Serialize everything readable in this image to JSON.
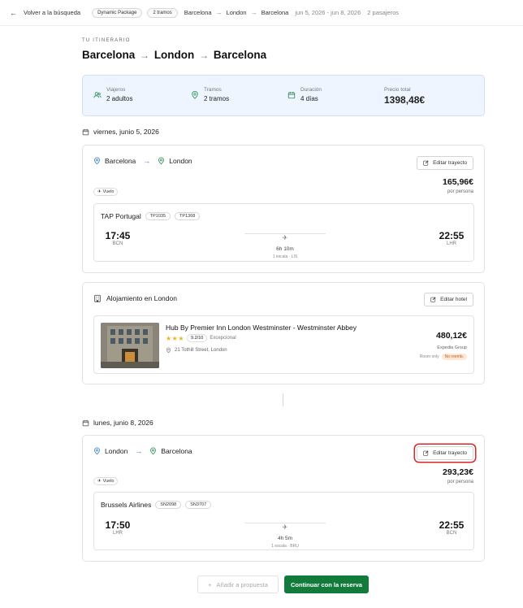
{
  "topbar": {
    "back_label": "Volver a la búsqueda",
    "package_badge": "Dynamic Package",
    "legs_badge": "2 tramos",
    "route": [
      "Barcelona",
      "London",
      "Barcelona"
    ],
    "dates": "jun 5, 2026 - jun 8, 2026",
    "passengers": "2 pasajeros"
  },
  "header": {
    "kicker": "TU ITINERARIO",
    "route": [
      "Barcelona",
      "London",
      "Barcelona"
    ]
  },
  "summary": {
    "travelers_label": "Viajeros",
    "travelers_value": "2 adultos",
    "legs_label": "Tramos",
    "legs_value": "2 tramos",
    "duration_label": "Duración",
    "duration_value": "4 días",
    "price_label": "Precio total",
    "price_value": "1398,48€"
  },
  "day1": {
    "date": "viernes, junio 5, 2026",
    "flight": {
      "from": "Barcelona",
      "to": "London",
      "edit_label": "Editar trayecto",
      "type_badge": "Vuelo",
      "price": "165,96€",
      "per_person": "por persona",
      "airline": "TAP Portugal",
      "codes": [
        "TP1035",
        "TP1368"
      ],
      "dep_time": "17:45",
      "dep_iata": "BCN",
      "duration": "6h 10m",
      "stops": "1 escala · LIS",
      "arr_time": "22:55",
      "arr_iata": "LHR"
    },
    "hotel": {
      "title": "Alojamiento en London",
      "edit_label": "Editar hotel",
      "name": "Hub By Premier Inn London Westminster - Westminster Abbey",
      "stars": 3,
      "rating": "9.2/10",
      "rating_text": "Excepcional",
      "address": "21 Tothill Street, London",
      "price": "480,12€",
      "provider": "Expedia Group",
      "room": "Room only",
      "refund": "No reemb."
    }
  },
  "day2": {
    "date": "lunes, junio 8, 2026",
    "flight": {
      "from": "London",
      "to": "Barcelona",
      "edit_label": "Editar trayecto",
      "type_badge": "Vuelo",
      "price": "293,23€",
      "per_person": "por persona",
      "airline": "Brussels Airlines",
      "codes": [
        "SN2098",
        "SN3707"
      ],
      "dep_time": "17:50",
      "dep_iata": "LHR",
      "duration": "4h 5m",
      "stops": "1 escala · BRU",
      "arr_time": "22:55",
      "arr_iata": "BCN"
    }
  },
  "footer": {
    "add_label": "Añadir a propuesta",
    "continue_label": "Continuar con la reserva"
  },
  "colors": {
    "accent_green": "#127a3b",
    "highlight_red": "#d9262b",
    "summary_bg": "#eef5fe",
    "star": "#f3b21b"
  }
}
